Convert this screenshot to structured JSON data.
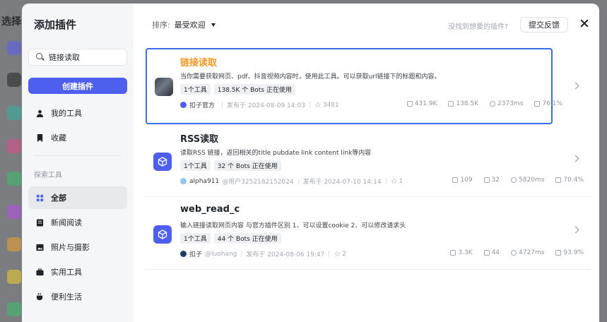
{
  "background": {
    "title": "选择"
  },
  "modal": {
    "title": "添加插件",
    "search": {
      "value": "链接读取",
      "placeholder": ""
    },
    "create_button": "创建插件",
    "nav_top": [
      {
        "label": "我的工具",
        "icon": "user-icon"
      },
      {
        "label": "收藏",
        "icon": "star-icon"
      }
    ],
    "section_label": "探索工具",
    "nav_explore": [
      {
        "label": "全部",
        "icon": "grid-icon",
        "active": true
      },
      {
        "label": "新闻阅读",
        "icon": "news-icon"
      },
      {
        "label": "照片与摄影",
        "icon": "photo-icon"
      },
      {
        "label": "实用工具",
        "icon": "toolbox-icon"
      },
      {
        "label": "便利生活",
        "icon": "life-icon"
      }
    ]
  },
  "topbar": {
    "sort_label": "排序:",
    "sort_value": "最受欢迎",
    "not_found_text": "没找到想要的插件?",
    "feedback_button": "提交反馈"
  },
  "plugins": [
    {
      "name": "链接读取",
      "description": "当你需要获取网页、pdf、抖音视频内容时，使用此工具。可以获取url链接下的标题和内容。",
      "tools": "1个工具",
      "bots": "138.5K 个 Bots 正在使用",
      "author": "扣子官方",
      "published": "发布于 2024-08-09 14:03",
      "stars": "3481",
      "stat_views": "431.9K",
      "stat_bots": "138.5K",
      "stat_time": "2373ms",
      "stat_rate": "76.1%",
      "selected": true
    },
    {
      "name": "RSS读取",
      "description": "读取RSS 链接，返回相关的title pubdate link content link等内容",
      "tools": "1个工具",
      "bots": "32 个 Bots 正在使用",
      "author": "alpha911",
      "handle": "@用户3252182152024",
      "published": "发布于 2024-07-10 14:14",
      "stars": "1",
      "stat_views": "109",
      "stat_bots": "32",
      "stat_time": "5820ms",
      "stat_rate": "70.4%"
    },
    {
      "name": "web_read_c",
      "description": "输入链接读取网页内容 与官方插件区别 1、可以设置cookie 2、可以修改请求头",
      "tools": "1个工具",
      "bots": "44 个 Bots 正在使用",
      "author": "扣子",
      "handle": "@luohang",
      "published": "发布于 2024-08-06 19:47",
      "stars": "2",
      "stat_views": "3.3K",
      "stat_bots": "44",
      "stat_time": "4727ms",
      "stat_rate": "93.9%"
    }
  ],
  "colors": {
    "accent": "#4e5ff0",
    "selected_border": "#3a6ee8",
    "selected_title": "#f39a26"
  }
}
